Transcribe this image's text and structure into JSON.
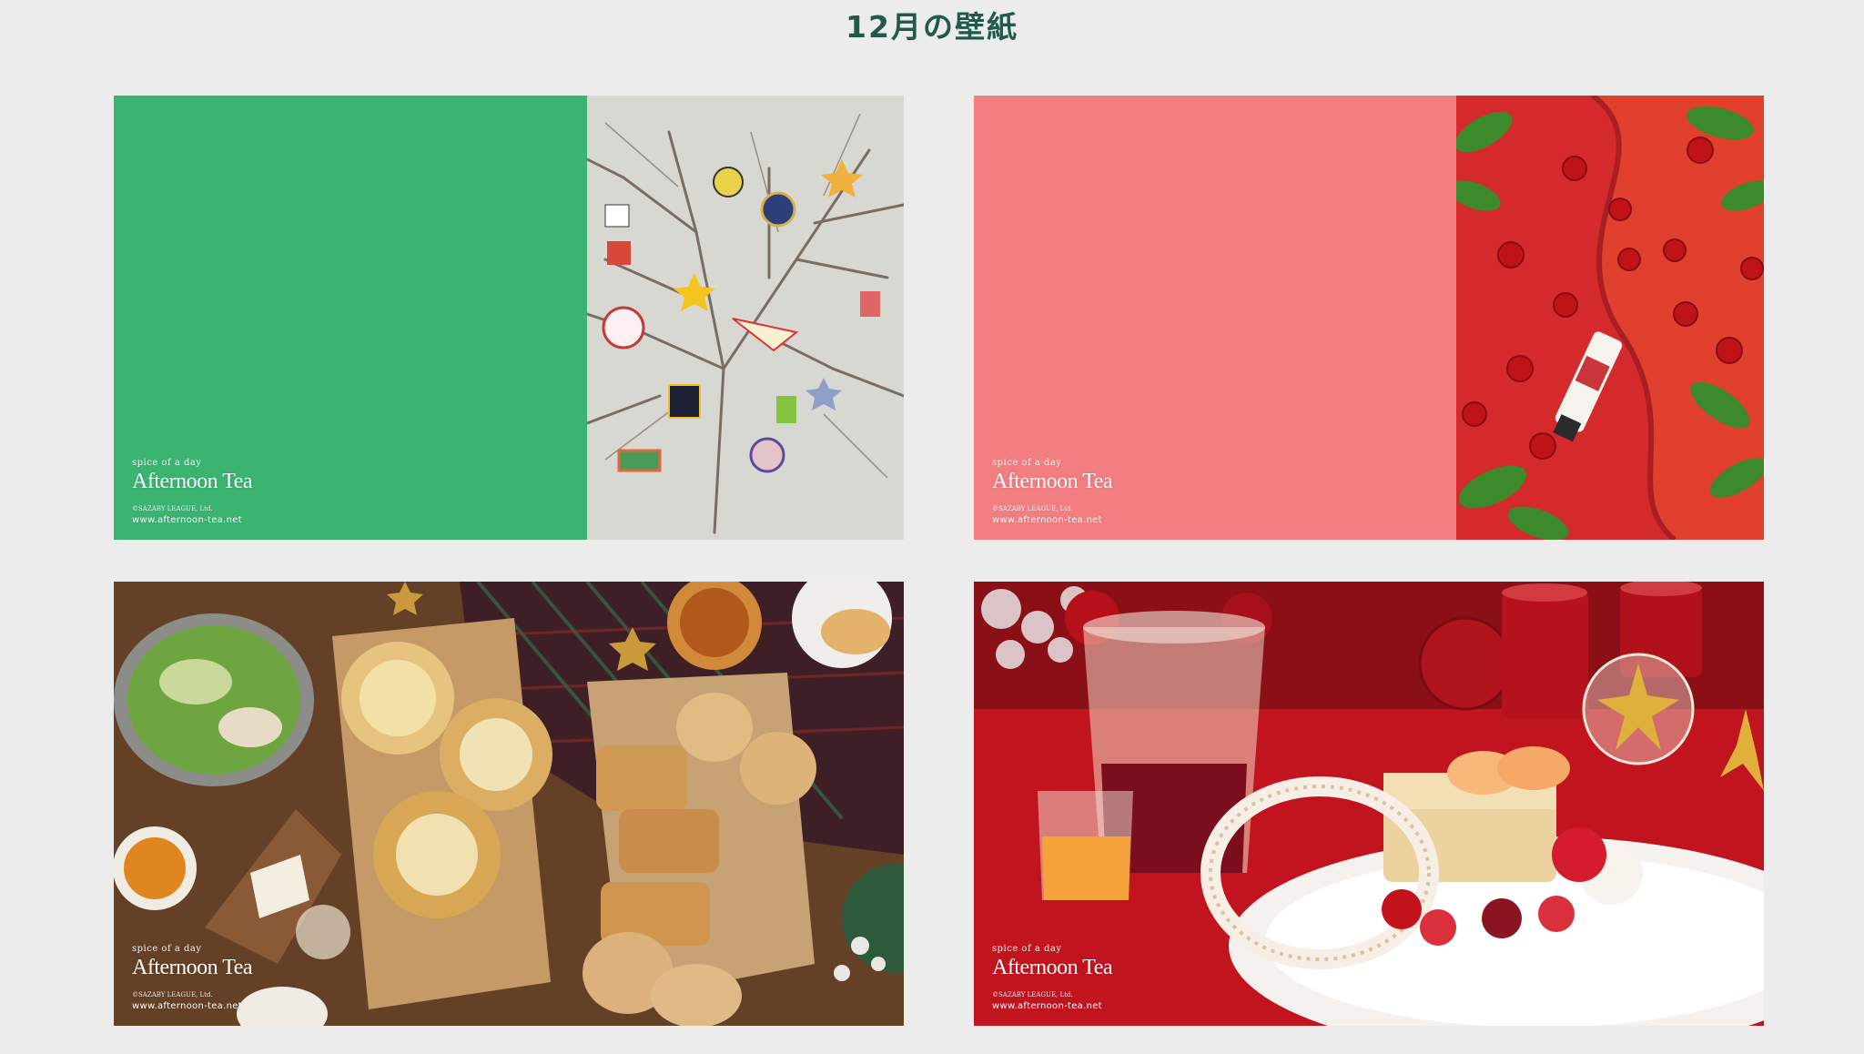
{
  "page": {
    "title": "12月の壁紙"
  },
  "wallpapers": [
    {
      "solid_color": "#3bb371",
      "photo": "ornament-branches",
      "brand": {
        "tagline": "spice of a day",
        "logo": "Afternoon Tea",
        "copyright": "©SAZABY LEAGUE, Ltd.",
        "url": "www.afternoon-tea.net"
      }
    },
    {
      "solid_color": "#f27e82",
      "photo": "cherries-hand-cream",
      "brand": {
        "tagline": "spice of a day",
        "logo": "Afternoon Tea",
        "copyright": "©SAZABY LEAGUE, Ltd.",
        "url": "www.afternoon-tea.net"
      }
    },
    {
      "photo": "christmas-bread-table",
      "brand": {
        "tagline": "spice of a day",
        "logo": "Afternoon Tea",
        "copyright": "©SAZABY LEAGUE, Ltd.",
        "url": "www.afternoon-tea.net"
      }
    },
    {
      "photo": "apple-dessert-tea",
      "brand": {
        "tagline": "spice of a day",
        "logo": "Afternoon Tea",
        "copyright": "©SAZABY LEAGUE, Ltd.",
        "url": "www.afternoon-tea.net"
      }
    }
  ],
  "colors": {
    "title": "#1f5a4a",
    "background": "#ececec"
  }
}
